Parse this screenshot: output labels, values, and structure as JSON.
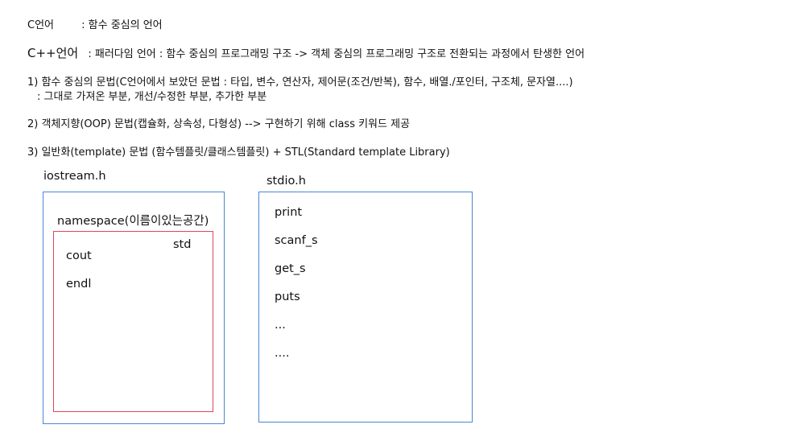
{
  "notes": {
    "c_name": "C언어",
    "c_desc": ": 함수 중심의 언어",
    "cpp_name": "C++언어",
    "cpp_desc": ": 패러다임 언어 : 함수 중심의 프로그래밍 구조 -> 객체 중심의 프로그래밍 구조로 전환되는 과정에서 탄생한 언어",
    "item1_prefix": "1) 함수 중심의 문법(",
    "item1_main": "C언어에서 보았던 문법 : 타입, 변수, 연산자, 제어문(조건/반복), 함수, 배열./포인터, 구조체, 문자열....)",
    "item1_sub": ": 그대로 가져온 부분, 개선/수정한 부분, 추가한 부분",
    "item2": "2) 객체지향(OOP) 문법(캡슐화, 상속성, 다형성) --> 구현하기 위해 class 키워드 제공",
    "item3": "3) 일반화(template) 문법 (함수템플릿/클래스템플릿) + STL(Standard template Library)"
  },
  "diagram": {
    "iostream": {
      "title": "iostream.h",
      "namespace_label": "namespace(이름이있는공간)",
      "std_label": "std",
      "members": [
        "cout",
        "endl"
      ]
    },
    "stdio": {
      "title": "stdio.h",
      "members": [
        "print",
        "scanf_s",
        "get_s",
        "puts",
        "...",
        "...."
      ]
    }
  },
  "colors": {
    "blue_border": "#4a86d4",
    "red_border": "#e0455a"
  }
}
